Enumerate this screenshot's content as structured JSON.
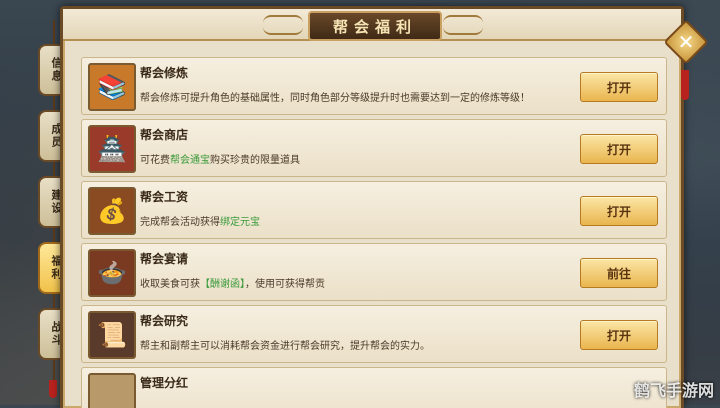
{
  "title": "帮会福利",
  "close_icon": "close-x-icon",
  "side_tabs": [
    {
      "label": "信息",
      "active": false
    },
    {
      "label": "成员",
      "active": false
    },
    {
      "label": "建设",
      "active": false
    },
    {
      "label": "福利",
      "active": true
    },
    {
      "label": "战斗",
      "active": false
    }
  ],
  "rows": [
    {
      "title": "帮会修炼",
      "icon": "cultivation-book-icon",
      "desc_pre": "帮会修炼可提升角色的基础属性，同时角色部分等级提升时也需要达到一定的修炼等级！",
      "desc_hl": "",
      "desc_post": "",
      "button": "打开"
    },
    {
      "title": "帮会商店",
      "icon": "shop-building-icon",
      "desc_pre": "可花费",
      "desc_hl": "帮会通宝",
      "desc_post": "购买珍贵的限量道具",
      "button": "打开"
    },
    {
      "title": "帮会工资",
      "icon": "coin-pile-icon",
      "desc_pre": "完成帮会活动获得",
      "desc_hl": "绑定元宝",
      "desc_post": "",
      "button": "打开"
    },
    {
      "title": "帮会宴请",
      "icon": "feast-plate-icon",
      "desc_pre": "收取美食可获",
      "desc_hl": "【酬谢函】",
      "desc_post": "，使用可获得帮贡",
      "button": "前往"
    },
    {
      "title": "帮会研究",
      "icon": "research-table-icon",
      "desc_pre": "帮主和副帮主可以消耗帮会资金进行帮会研究，提升帮会的实力。",
      "desc_hl": "",
      "desc_post": "",
      "button": "打开"
    },
    {
      "title": "管理分红",
      "icon": "dividend-icon",
      "desc_pre": "",
      "desc_hl": "",
      "desc_post": "",
      "button": ""
    }
  ],
  "watermark": "鹤飞手游网"
}
